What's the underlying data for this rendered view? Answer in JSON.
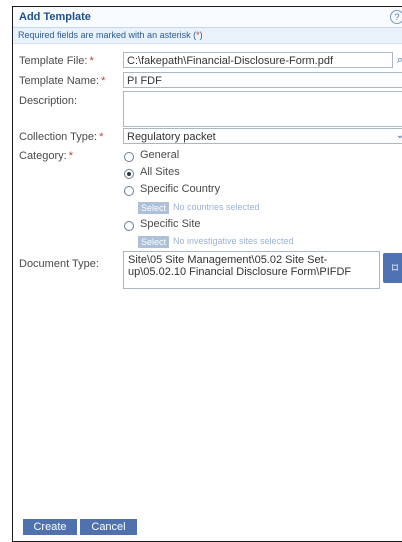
{
  "dialog": {
    "title": "Add Template",
    "help_icon": "help-icon",
    "required_note_prefix": "Required fields are marked with an asterisk (",
    "required_note_star": "*",
    "required_note_suffix": ")"
  },
  "form": {
    "template_file_label": "Template File:",
    "template_file_value": "C:\\fakepath\\Financial-Disclosure-Form.pdf",
    "template_name_label": "Template Name:",
    "template_name_value": "PI FDF",
    "description_label": "Description:",
    "description_value": "",
    "collection_type_label": "Collection Type:",
    "collection_type_value": "Regulatory packet",
    "category_label": "Category:",
    "category_options": [
      {
        "label": "General",
        "checked": false
      },
      {
        "label": "All Sites",
        "checked": true
      },
      {
        "label": "Specific Country",
        "checked": false
      },
      {
        "label": "Specific Site",
        "checked": false
      }
    ],
    "country_select_label": "Select",
    "country_select_note": "No countries selected",
    "site_select_label": "Select",
    "site_select_note": "No investigative sites selected",
    "document_type_label": "Document Type:",
    "document_type_value": "Site\\05 Site Management\\05.02 Site Set-up\\05.02.10 Financial Disclosure Form\\PIFDF"
  },
  "footer": {
    "create_label": "Create",
    "cancel_label": "Cancel"
  },
  "colors": {
    "accent": "#4f71ad",
    "required": "#c43b3b",
    "title": "#1f4f8a"
  },
  "icons": {
    "file_browse": "search-icon",
    "select_dropdown": "chevron-down-icon",
    "document_type_picker": "tag-icon"
  }
}
